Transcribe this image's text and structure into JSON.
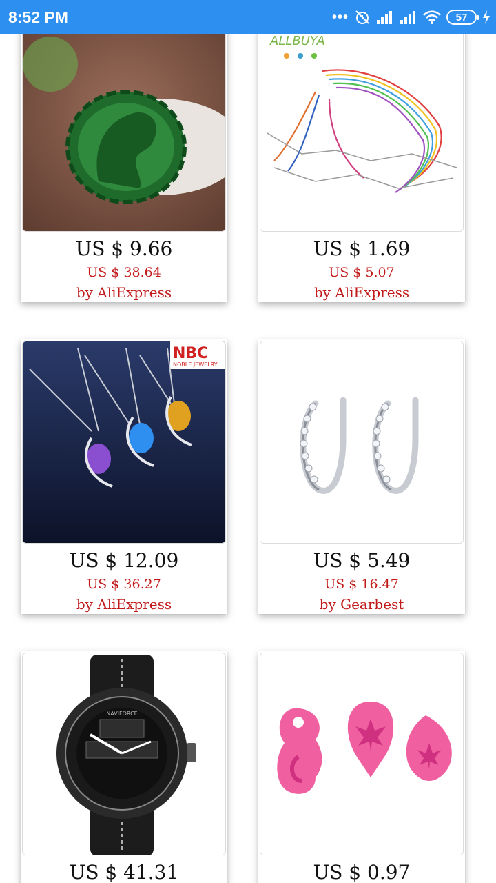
{
  "status_bar": {
    "time": "8:52 PM",
    "dots": "•••",
    "battery": "57",
    "bg_color": "#2d8ff0"
  },
  "products": [
    {
      "price": "US $ 9.66",
      "old_price": "US $ 38.64",
      "seller": "by AliExpress",
      "image": "green-jade-horse-pendant"
    },
    {
      "price": "US $ 1.69",
      "old_price": "US $ 5.07",
      "seller": "by AliExpress",
      "image": "colorful-cord-necklaces",
      "image_text": "ALLBUYA"
    },
    {
      "price": "US $ 12.09",
      "old_price": "US $ 36.27",
      "seller": "by AliExpress",
      "image": "gemstone-pendant-necklaces",
      "image_text": "NBC",
      "image_subtext": "NOBLE JEWELRY"
    },
    {
      "price": "US $ 5.49",
      "old_price": "US $ 16.47",
      "seller": "by Gearbest",
      "image": "silver-hoop-earrings"
    },
    {
      "price": "US $ 41.31",
      "old_price": "",
      "seller": "",
      "image": "black-sport-watch",
      "image_text": "NAVIFORCE"
    },
    {
      "price": "US $ 0.97",
      "old_price": "",
      "seller": "",
      "image": "pink-silicone-molds"
    }
  ],
  "colors": {
    "accent_red": "#c21a1a",
    "status_blue": "#2d8ff0"
  }
}
